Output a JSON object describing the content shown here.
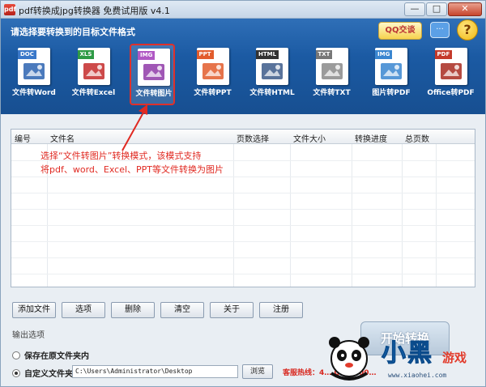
{
  "window": {
    "title": "pdf转换成jpg转换器 免费试用版 v4.1",
    "app_icon_glyph": "pdf",
    "minimize_glyph": "—",
    "maximize_glyph": "□",
    "close_glyph": "✕"
  },
  "header": {
    "title": "请选择要转换到的目标文件格式",
    "qq_label": "QQ交谈",
    "chat_glyph": "···",
    "help_glyph": "?"
  },
  "tools": [
    {
      "tag": "DOC",
      "label": "文件转Word",
      "tag_color": "#3a78c9",
      "art_color": "#2b63b0",
      "icon": "word-doc-icon"
    },
    {
      "tag": "XLS",
      "label": "文件转Excel",
      "tag_color": "#2e9a45",
      "art_color": "#c42a2a",
      "icon": "excel-chart-icon"
    },
    {
      "tag": "IMG",
      "label": "文件转图片",
      "tag_color": "#b058c4",
      "art_color": "#8f3aa8",
      "icon": "image-check-icon",
      "selected": true
    },
    {
      "tag": "PPT",
      "label": "文件转PPT",
      "tag_color": "#e25c2c",
      "art_color": "#e25c2c",
      "icon": "ppt-doc-icon"
    },
    {
      "tag": "HTML",
      "label": "文件转HTML",
      "tag_color": "#333333",
      "art_color": "#3c5a8a",
      "icon": "html-globe-icon"
    },
    {
      "tag": "TXT",
      "label": "文件转TXT",
      "tag_color": "#777777",
      "art_color": "#8a8a8a",
      "icon": "txt-doc-icon"
    },
    {
      "tag": "IMG",
      "label": "图片转PDF",
      "tag_color": "#3a86d0",
      "art_color": "#3a86d0",
      "icon": "image-to-pdf-icon"
    },
    {
      "tag": "PDF",
      "label": "Office转PDF",
      "tag_color": "#c43a2a",
      "art_color": "#a82a20",
      "icon": "pdf-acrobat-icon"
    }
  ],
  "table": {
    "columns": [
      "编号",
      "文件名",
      "页数选择",
      "文件大小",
      "转换进度",
      "总页数"
    ]
  },
  "annotation": {
    "line1": "选择“文件转图片”转换模式，该模式支持",
    "line2": "将pdf、word、Excel、PPT等文件转换为图片"
  },
  "buttons": [
    "添加文件",
    "选项",
    "删除",
    "清空",
    "关于",
    "注册"
  ],
  "output": {
    "title": "输出选项",
    "option_original": "保存在原文件夹内",
    "option_custom": "自定义文件夹",
    "path_value": "C:\\Users\\Administrator\\Desktop",
    "browse_label": "浏览",
    "hotline": "客服热线：4… QQ…800…"
  },
  "start_label": "开始转换",
  "watermark": {
    "brand": "小黑",
    "brand_suffix": "游戏",
    "url": "www.xiaohei.com"
  }
}
